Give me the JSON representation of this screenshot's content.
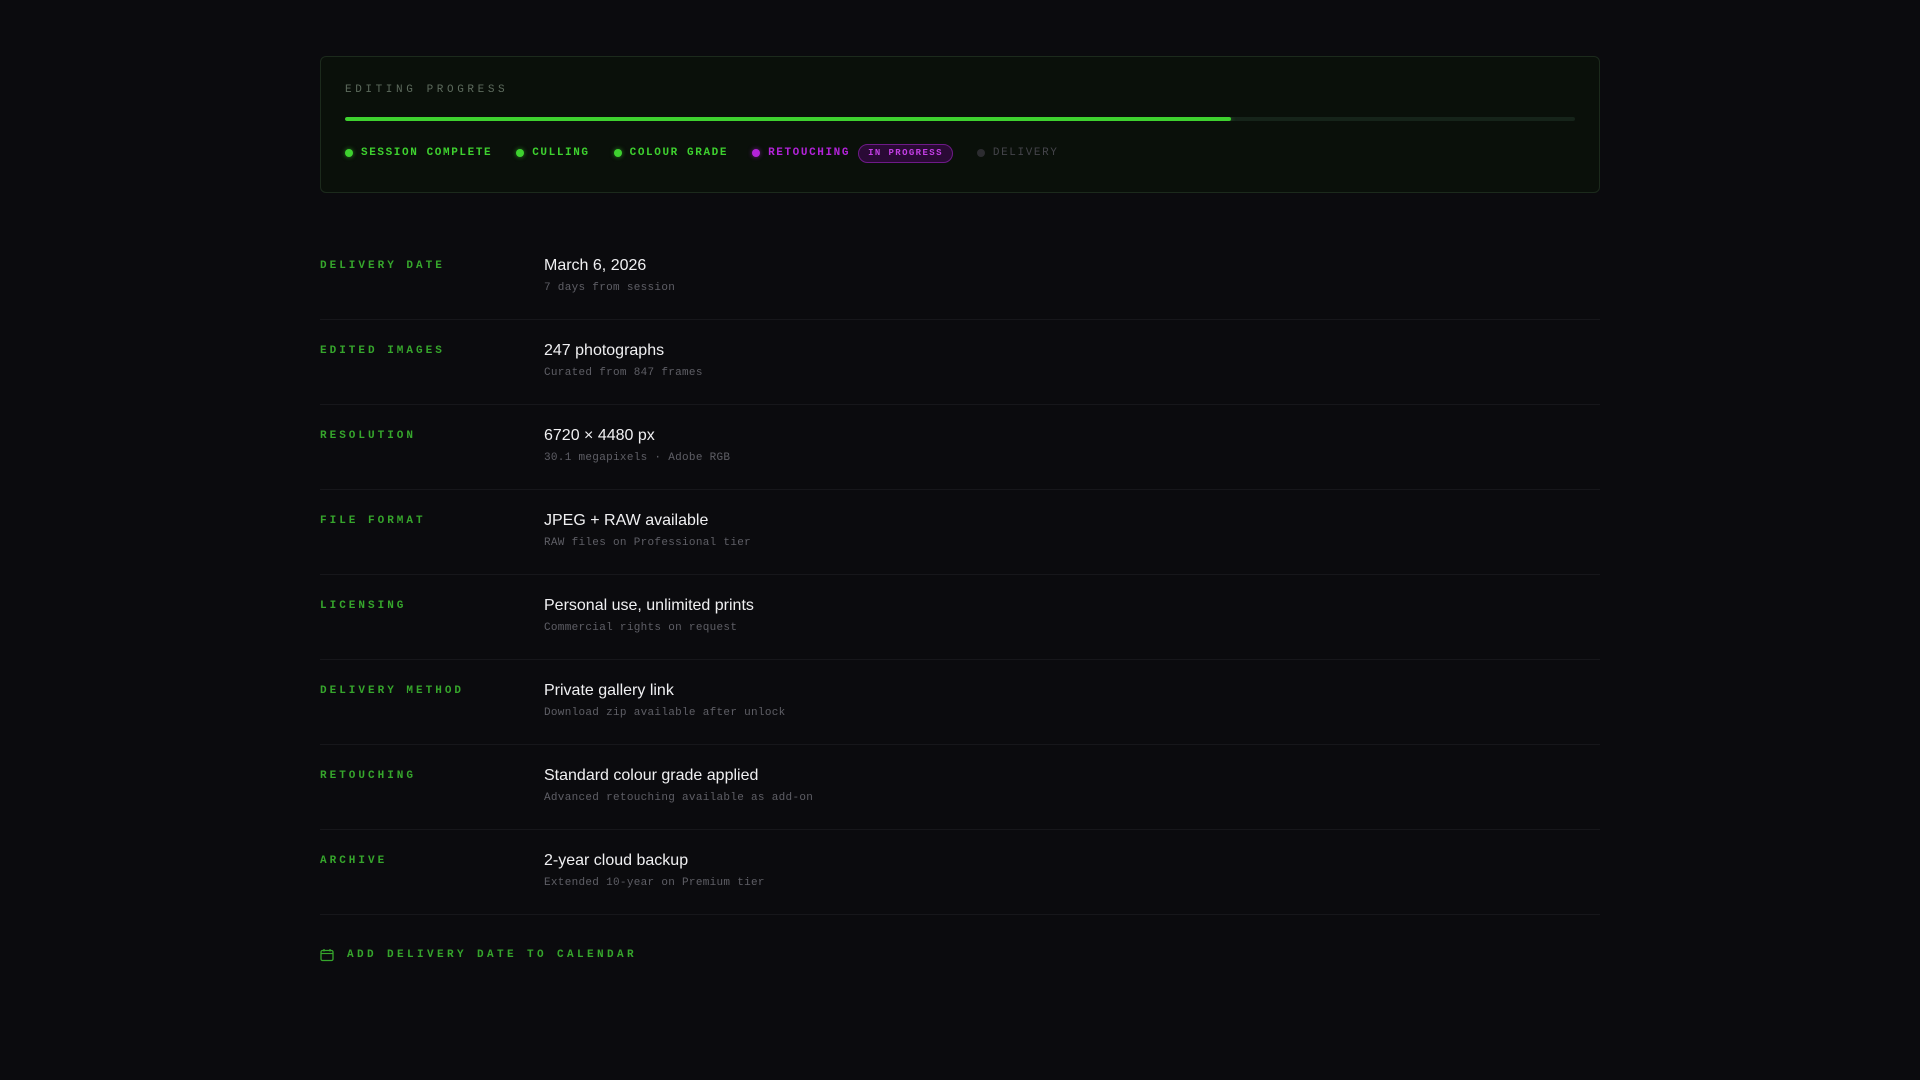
{
  "progress": {
    "title": "EDITING PROGRESS",
    "percent_complete": 72,
    "steps": [
      {
        "label": "SESSION COMPLETE",
        "state": "complete"
      },
      {
        "label": "CULLING",
        "state": "complete"
      },
      {
        "label": "COLOUR GRADE",
        "state": "complete"
      },
      {
        "label": "RETOUCHING",
        "state": "in-progress",
        "badge": "IN PROGRESS"
      },
      {
        "label": "DELIVERY",
        "state": "pending"
      }
    ]
  },
  "details": [
    {
      "label": "DELIVERY DATE",
      "value": "March 6, 2026",
      "sub": "7 days from session"
    },
    {
      "label": "EDITED IMAGES",
      "value": "247 photographs",
      "sub": "Curated from 847 frames"
    },
    {
      "label": "RESOLUTION",
      "value": "6720 × 4480 px",
      "sub": "30.1 megapixels · Adobe RGB"
    },
    {
      "label": "FILE FORMAT",
      "value": "JPEG + RAW available",
      "sub": "RAW files on Professional tier"
    },
    {
      "label": "LICENSING",
      "value": "Personal use, unlimited prints",
      "sub": "Commercial rights on request"
    },
    {
      "label": "DELIVERY METHOD",
      "value": "Private gallery link",
      "sub": "Download zip available after unlock"
    },
    {
      "label": "RETOUCHING",
      "value": "Standard colour grade applied",
      "sub": "Advanced retouching available as add-on"
    },
    {
      "label": "ARCHIVE",
      "value": "2-year cloud backup",
      "sub": "Extended 10-year on Premium tier"
    }
  ],
  "calendar_link": {
    "label": "ADD DELIVERY DATE TO CALENDAR",
    "icon": "calendar-icon"
  },
  "colors": {
    "accent": "#3ed12f",
    "in_progress": "#b323d9",
    "pending": "#44444a",
    "background": "#0b0b0e"
  }
}
